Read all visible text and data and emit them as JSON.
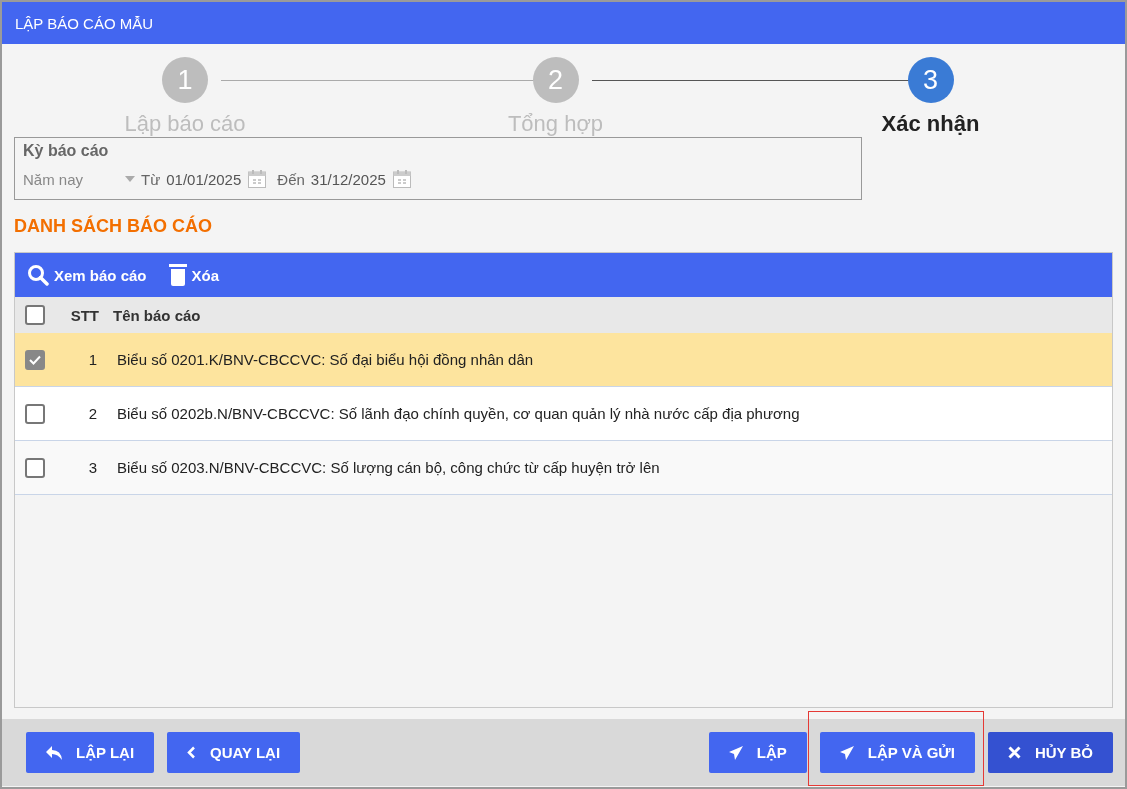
{
  "window": {
    "title": "LẬP BÁO CÁO MẪU"
  },
  "steps": [
    {
      "number": "1",
      "label": "Lập báo cáo",
      "selected": false
    },
    {
      "number": "2",
      "label": "Tổng hợp",
      "selected": false
    },
    {
      "number": "3",
      "label": "Xác nhận",
      "selected": true
    }
  ],
  "period": {
    "legend": "Kỳ báo cáo",
    "preset": "Năm nay",
    "from_label": "Từ",
    "from": "01/01/2025",
    "to_label": "Đến",
    "to": "31/12/2025"
  },
  "section_title": "DANH SÁCH BÁO CÁO",
  "toolbar": [
    {
      "kind": "view",
      "label": "Xem báo cáo"
    },
    {
      "kind": "delete",
      "label": "Xóa"
    }
  ],
  "table": {
    "columns": [
      "STT",
      "Tên báo cáo"
    ],
    "all_checked": false,
    "rows": [
      {
        "stt": "1",
        "name": "Biểu số 0201.K/BNV-CBCCVC: Số đại biểu hội đồng nhân dân",
        "checked": true,
        "selected": true
      },
      {
        "stt": "2",
        "name": "Biểu số 0202b.N/BNV-CBCCVC: Số lãnh đạo chính quyền, cơ quan quản lý nhà nước cấp địa phương",
        "checked": false,
        "selected": false
      },
      {
        "stt": "3",
        "name": "Biểu số 0203.N/BNV-CBCCVC: Số lượng cán bộ, công chức từ cấp huyện trở lên",
        "checked": false,
        "selected": false
      }
    ]
  },
  "footer": {
    "left": [
      {
        "kind": "redo",
        "label": "LẬP LẠI"
      },
      {
        "kind": "back",
        "label": "QUAY LẠI"
      }
    ],
    "right": [
      {
        "kind": "send",
        "label": "LẬP",
        "highlighted": false
      },
      {
        "kind": "send",
        "label": "LẬP VÀ GỬI",
        "highlighted": true
      },
      {
        "kind": "cancel",
        "label": "HỦY BỎ",
        "highlighted": false
      }
    ]
  }
}
